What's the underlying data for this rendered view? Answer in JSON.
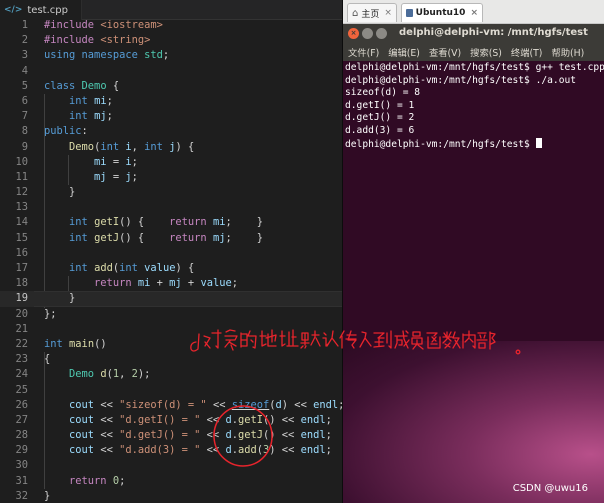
{
  "editor": {
    "tab_label": "test.cpp",
    "tab_icon": "C++",
    "current_line": 18
  },
  "terminal": {
    "vm_tabs": [
      {
        "label": "主页"
      },
      {
        "label": "Ubuntu10"
      }
    ],
    "window_title": "delphi@delphi-vm: /mnt/hgfs/test",
    "menu": [
      "文件(F)",
      "编辑(E)",
      "查看(V)",
      "搜索(S)",
      "终端(T)",
      "帮助(H)"
    ],
    "lines": [
      "delphi@delphi-vm:/mnt/hgfs/test$ g++ test.cpp",
      "delphi@delphi-vm:/mnt/hgfs/test$ ./a.out",
      "sizeof(d) = 8",
      "d.getI() = 1",
      "d.getJ() = 2",
      "d.add(3) = 6",
      "delphi@delphi-vm:/mnt/hgfs/test$ "
    ]
  },
  "annotation": {
    "handwriting": "d对象的地址默认传入到成员函数内部。"
  },
  "watermark": "CSDN @uwu16",
  "colors": {
    "editor_bg": "#1e1e1e",
    "terminal_bg": "#300a24",
    "annotation_red": "#e8242c"
  }
}
